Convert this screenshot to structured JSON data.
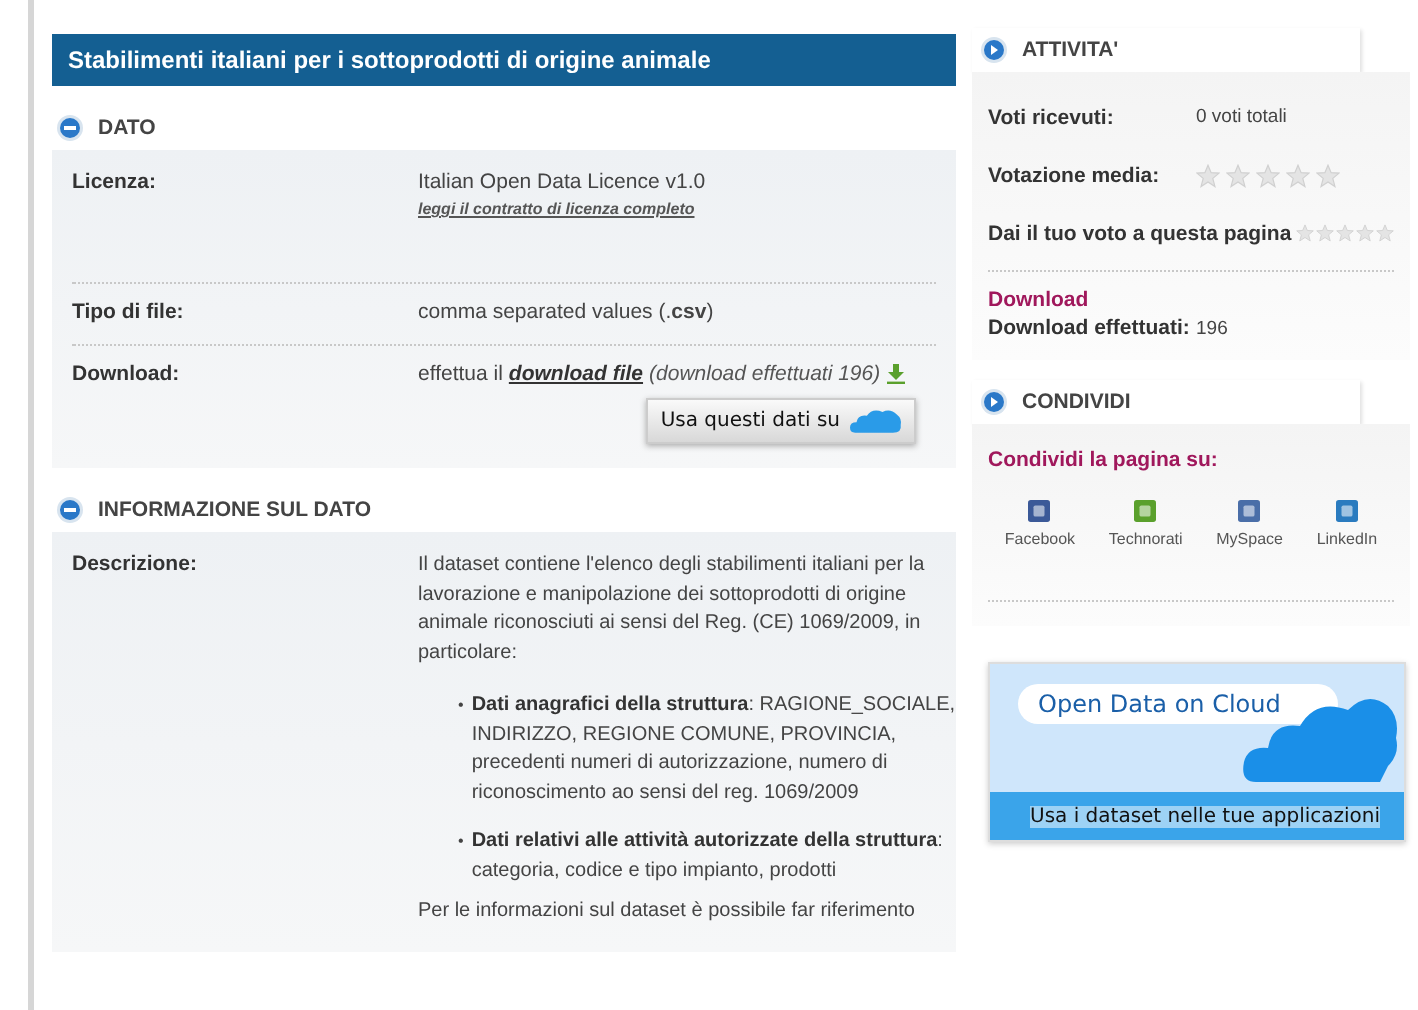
{
  "title": "Stabilimenti italiani per i sottoprodotti di origine animale",
  "sections": [
    {
      "heading": "DATO",
      "expanded": true,
      "rows": [
        {
          "kind": "license",
          "label": "Licenza:",
          "value": "Italian Open Data Licence v1.0",
          "link": "leggi il contratto di licenza completo"
        },
        {
          "kind": "text",
          "label": "Tipo di file:",
          "value": "comma separated values (.**csv**)"
        },
        {
          "kind": "download",
          "label": "Download:",
          "prefix": "effettua il",
          "link": "download file",
          "note": "(download effettuati 196)",
          "button": "Usa questi dati su"
        }
      ]
    },
    {
      "heading": "INFORMAZIONE SUL DATO",
      "expanded": true,
      "rows": [
        {
          "kind": "description",
          "label": "Descrizione:",
          "intro": "Il dataset contiene l'elenco degli stabilimenti italiani per la lavorazione e manipolazione dei sottoprodotti di origine animale riconosciuti ai sensi del Reg. (CE) 1069/2009, in particolare:",
          "bullets": [
            {
              "marker": "•",
              "text": "**Dati anagrafici della struttura**: RAGIONE_SOCIALE, INDIRIZZO, REGIONE COMUNE, PROVINCIA, precedenti numeri di autorizzazione, numero di riconoscimento ao sensi del reg. 1069/2009"
            },
            {
              "marker": "•",
              "text": "**Dati relativi alle attività autorizzate della struttura**: categoria, codice e tipo impianto, prodotti"
            }
          ],
          "outro": "Per le informazioni sul dataset è possibile far riferimento"
        }
      ]
    }
  ],
  "activity": {
    "heading": "ATTIVITA'",
    "votes_label": "Voti ricevuti:",
    "votes_value": "0 voti totali",
    "average": {
      "label": "Votazione media:",
      "stars": 0
    },
    "vote": {
      "label": "Dai il tuo voto a questa pagina",
      "stars": 0
    },
    "download_heading": "Download",
    "downloads_label": "Download effettuati:",
    "downloads_value": "196"
  },
  "share": {
    "heading": "CONDIVIDI",
    "prompt": "Condividi la pagina su:",
    "networks": [
      {
        "kind": "facebook",
        "label": "Facebook"
      },
      {
        "kind": "technorati",
        "label": "Technorati"
      },
      {
        "kind": "myspace",
        "label": "MySpace"
      },
      {
        "kind": "linkedin",
        "label": "LinkedIn"
      }
    ]
  },
  "banner": {
    "title": "Open Data on Cloud",
    "caption": "Usa i dataset nelle tue applicazioni"
  }
}
